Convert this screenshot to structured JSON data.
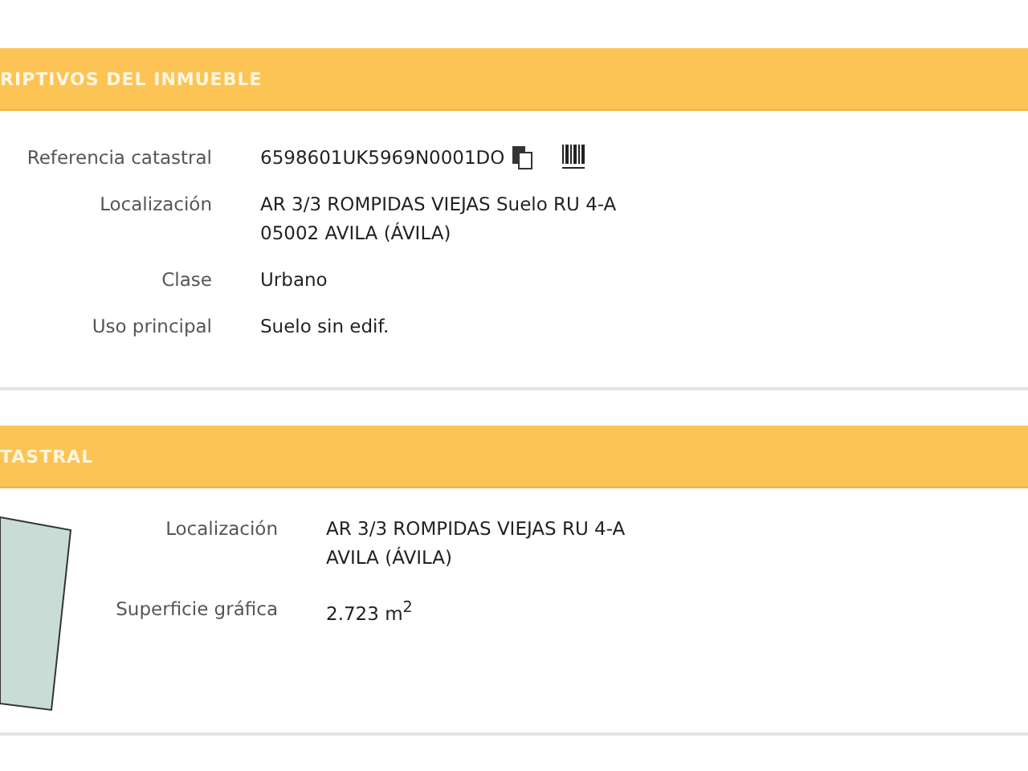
{
  "sections": [
    {
      "title": "RIPTIVOS DEL INMUEBLE",
      "kind": "plain",
      "rows": [
        {
          "label": "Referencia catastral",
          "kind": "reference",
          "lines": [
            "6598601UK5969N0001DO"
          ]
        },
        {
          "label": "Localización",
          "kind": "text",
          "lines": [
            "AR 3/3 ROMPIDAS VIEJAS Suelo RU 4-A",
            "05002 AVILA (ÁVILA)"
          ]
        },
        {
          "label": "Clase",
          "kind": "text",
          "lines": [
            "Urbano"
          ]
        },
        {
          "label": "Uso principal",
          "kind": "text",
          "lines": [
            "Suelo sin edif."
          ]
        }
      ]
    },
    {
      "title": "TASTRAL",
      "kind": "map",
      "rows": [
        {
          "label": "Localización",
          "kind": "text",
          "lines": [
            "AR 3/3 ROMPIDAS VIEJAS RU 4-A",
            "AVILA (ÁVILA)"
          ]
        },
        {
          "label": "Superficie gráfica",
          "kind": "text",
          "lines": [
            "2.723 m$^{2}$"
          ]
        }
      ]
    }
  ]
}
